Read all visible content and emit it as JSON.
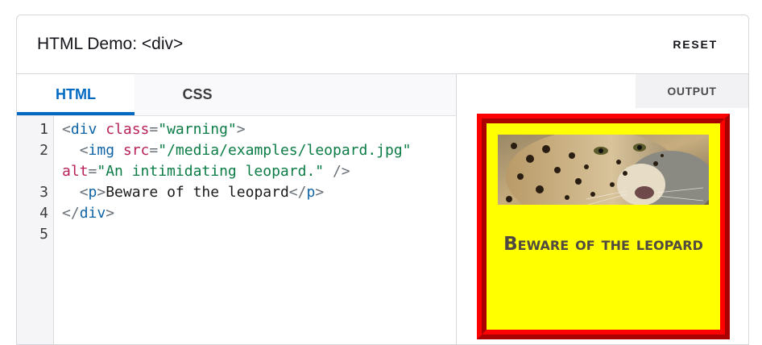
{
  "header": {
    "title": "HTML Demo: <div>",
    "reset_label": "RESET"
  },
  "editor": {
    "tabs": [
      {
        "label": "HTML",
        "active": true
      },
      {
        "label": "CSS",
        "active": false
      }
    ],
    "line_numbers": [
      "1",
      "2",
      "",
      "3",
      "4",
      "5"
    ],
    "code": {
      "line1": {
        "open": "<",
        "tag": "div",
        "attr": " class",
        "eq": "=",
        "val": "\"warning\"",
        "close": ">"
      },
      "line2a": {
        "indent": "  ",
        "open": "<",
        "tag": "img",
        "attr": " src",
        "eq": "=",
        "val": "\"/media/examples/leopard.jpg\""
      },
      "line2b": {
        "attr": "alt",
        "eq": "=",
        "val": "\"An intimidating leopard.\"",
        "close": " />"
      },
      "line3": {
        "indent": "  ",
        "open": "<",
        "tag": "p",
        "close": ">",
        "text": "Beware of the leopard",
        "end_open": "</",
        "end_tag": "p",
        "end_close": ">"
      },
      "line4": {
        "open": "</",
        "tag": "div",
        "close": ">"
      }
    }
  },
  "output": {
    "label": "OUTPUT",
    "warning_text": "Beware of the leopard",
    "image_alt": "An intimidating leopard.",
    "colors": {
      "box_background": "#ffff00",
      "box_border": "#ff0000",
      "text": "#514a41",
      "active_tab": "#0069c2"
    }
  }
}
